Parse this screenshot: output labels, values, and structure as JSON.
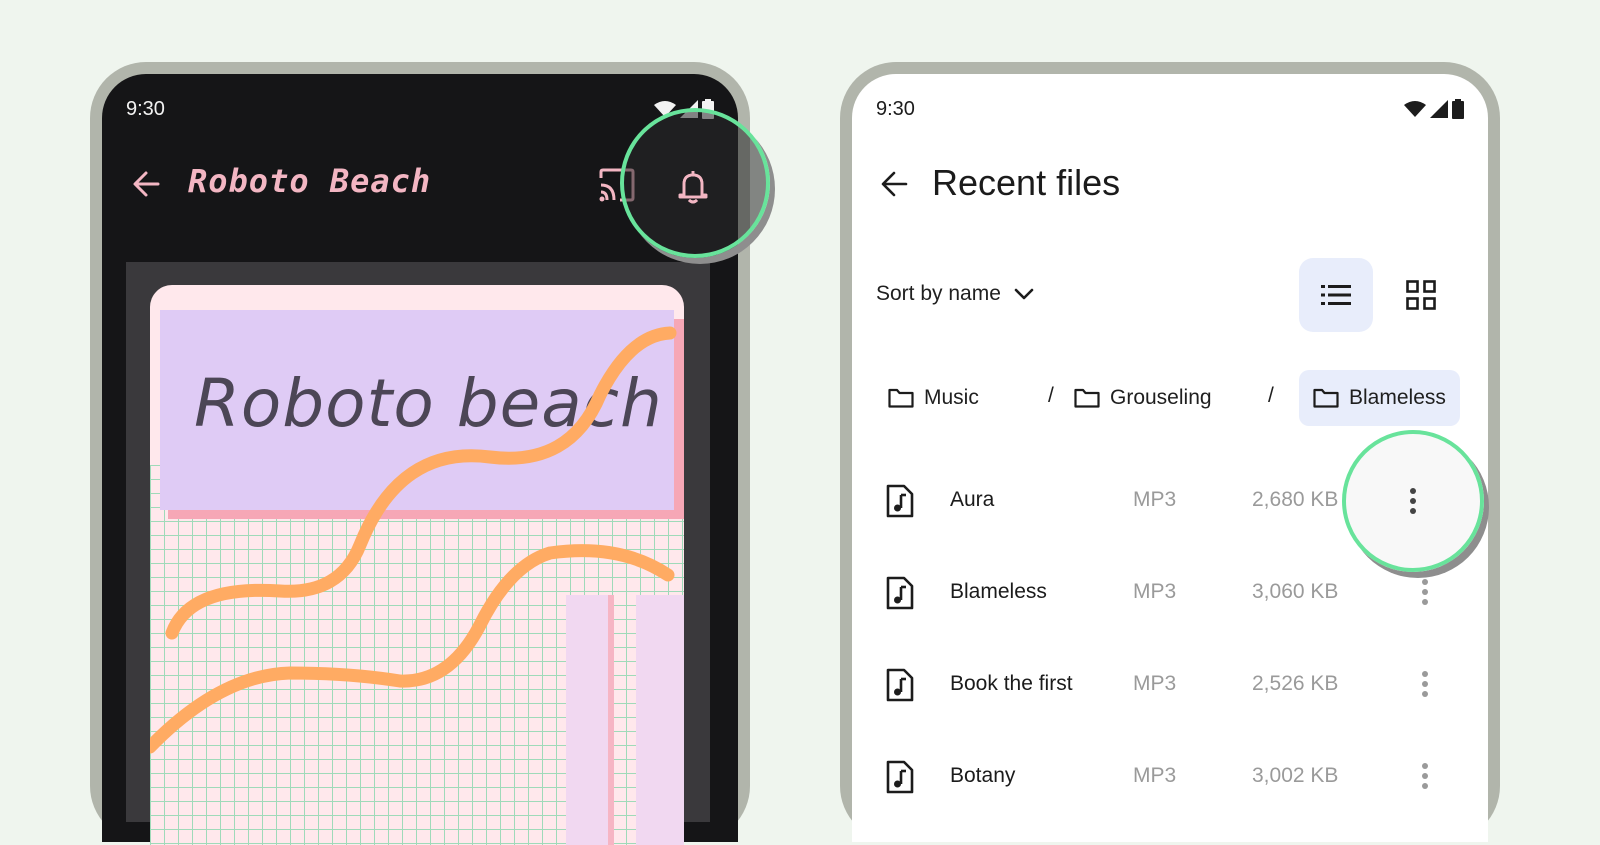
{
  "left_phone": {
    "status_time": "9:30",
    "app_title": "Roboto Beach",
    "poster_text": "Roboto beach",
    "accent_color": "#f3b6c3"
  },
  "right_phone": {
    "status_time": "9:30",
    "app_title": "Recent files",
    "sort_label": "Sort by name",
    "breadcrumbs": [
      {
        "label": "Music"
      },
      {
        "label": "Grouseling"
      },
      {
        "label": "Blameless"
      }
    ],
    "breadcrumb_separator": "/",
    "files": [
      {
        "name": "Aura",
        "type": "MP3",
        "size": "2,680 KB"
      },
      {
        "name": "Blameless",
        "type": "MP3",
        "size": "3,060 KB"
      },
      {
        "name": "Book the first",
        "type": "MP3",
        "size": "2,526 KB"
      },
      {
        "name": "Botany",
        "type": "MP3",
        "size": "3,002 KB"
      }
    ],
    "selected_view": "list",
    "focus_ring_color": "#68e39b"
  }
}
